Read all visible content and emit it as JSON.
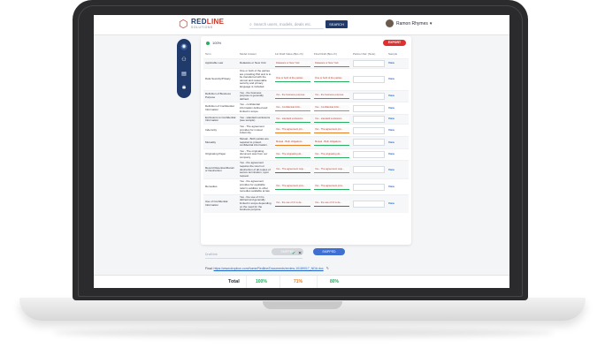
{
  "app": {
    "logo_name_a": "RED",
    "logo_name_b": "LINE",
    "logo_sub": "SOLUTIONS",
    "search_placeholder": "Search users, models, deals etc.",
    "search_button": "SEARCH",
    "user_name": "Ramon Rhymes",
    "user_caret": "▾"
  },
  "status": {
    "label": "100%"
  },
  "export_label": "EXPORT",
  "columns": [
    "Term",
    "Model Answer",
    "1st Draft Value (Bps ch)",
    "Final Draft (Bps ch)",
    "Partner Ref. (Note)",
    "Sample"
  ],
  "rows": [
    {
      "term": "Applicable Law",
      "model": "Delaware or New York",
      "first": "Delaware or New York",
      "first_c": "green",
      "final": "Delaware or New York",
      "final_c": "green",
      "sample": "View"
    },
    {
      "term": "Data Security/Privacy",
      "model": "One or both of the parties are providing PHI and is to be transferred with the utmost and reasonable security and privacy language is included.",
      "first": "One or both of the parties",
      "first_c": "green",
      "final": "One or both of the parties",
      "final_c": "green",
      "sample": "View"
    },
    {
      "term": "Definition of Business Purpose",
      "model": "Yes - the business purpose is generally defined.",
      "first": "Yes - the business purpose",
      "first_c": "green",
      "final": "Yes - the business purpose",
      "final_c": "green",
      "sample": "View"
    },
    {
      "term": "Definition of Confidential Information",
      "model": "Yes - confidential information defined and limited in scope.",
      "first": "Yes - Confidential Infor...",
      "first_c": "orange",
      "final": "Yes - Confidential Infor...",
      "final_c": "orange",
      "sample": "View"
    },
    {
      "term": "Exclusions to Confidential Information",
      "model": "Yes - standard exclusions (see sample)",
      "first": "Yes - standard exclusions",
      "first_c": "green",
      "final": "Yes - standard exclusions",
      "final_c": "green",
      "sample": "View"
    },
    {
      "term": "Indemnity",
      "model": "Yes - The agreement provides for mutual indemnity.",
      "first": "Yes - The agreement pro...",
      "first_c": "orange",
      "final": "Yes - The agreement pro...",
      "final_c": "orange",
      "sample": "View"
    },
    {
      "term": "Mutuality",
      "model": "Mutual - Both parties are required to protect confidential information.",
      "first": "Mutual - Both obligations",
      "first_c": "orange",
      "final": "Mutual - Both obligations",
      "final_c": "green",
      "sample": "View"
    },
    {
      "term": "Originating Paper",
      "model": "Yes - The originating document was from our company.",
      "first": "Yes - The originating do...",
      "first_c": "green",
      "final": "Yes - The originating do...",
      "final_c": "green",
      "sample": "View"
    },
    {
      "term": "Record Retention/Return or Destruction",
      "model": "Yes - the agreement requires the return or destruction of all copies of secure termination, upon request.",
      "first": "Yes - The agreement requ...",
      "first_c": "red",
      "final": "Yes - The agreement requ...",
      "final_c": "orange",
      "sample": "View"
    },
    {
      "term": "Remedies",
      "model": "Yes - the agreement provides for equitable relief in addition to other remedies available at law.",
      "first": "Yes - The agreement prov...",
      "first_c": "green",
      "final": "Yes - The agreement prov...",
      "final_c": "green",
      "sample": "View"
    },
    {
      "term": "Use of Confidential Information",
      "model": "Yes - the use of CI is defined and generally limited in scope depending on the need for the business purpose.",
      "first": "Yes - the use of CI is de...",
      "first_c": "red",
      "final": "Yes - the use of CI is de...",
      "final_c": "red",
      "sample": "View"
    }
  ],
  "btn_gray": "SKIPPED",
  "btn_blue": "SKIPPED",
  "draft_placeholder": "Draft link",
  "final_label": "Final:",
  "final_link": "https://www.dropbox.com/home/Redline/Documents/review-10189017_NDA.doc",
  "totals": {
    "label": "Total",
    "v1": "100%",
    "v2": "71%",
    "v3": "80%"
  },
  "colors": {
    "green": "#27ae60",
    "orange": "#e67e22",
    "red": "#e02f2f",
    "navy": "#1f3a6b"
  }
}
